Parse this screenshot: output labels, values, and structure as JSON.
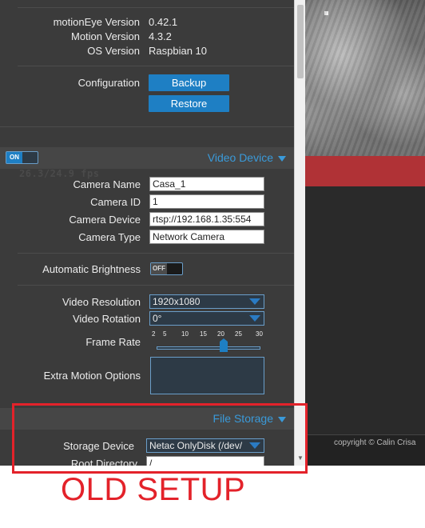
{
  "info": {
    "motioneye_version_label": "motionEye Version",
    "motioneye_version_value": "0.42.1",
    "motion_version_label": "Motion Version",
    "motion_version_value": "4.3.2",
    "os_version_label": "OS Version",
    "os_version_value": "Raspbian 10"
  },
  "configuration": {
    "label": "Configuration",
    "backup_label": "Backup",
    "restore_label": "Restore"
  },
  "video_device": {
    "toggle_label": "ON",
    "title": "Video Device",
    "camera_name_label": "Camera Name",
    "camera_name_value": "Casa_1",
    "camera_id_label": "Camera ID",
    "camera_id_value": "1",
    "camera_device_label": "Camera Device",
    "camera_device_value": "rtsp://192.168.1.35:554",
    "camera_type_label": "Camera Type",
    "camera_type_value": "Network Camera",
    "auto_brightness_label": "Automatic Brightness",
    "auto_brightness_toggle": "OFF",
    "video_resolution_label": "Video Resolution",
    "video_resolution_value": "1920x1080",
    "video_rotation_label": "Video Rotation",
    "video_rotation_value": "0°",
    "frame_rate_label": "Frame Rate",
    "frame_rate_ticks": [
      "2",
      "5",
      "10",
      "15",
      "20",
      "25",
      "30"
    ],
    "frame_rate_value": 20,
    "extra_motion_options_label": "Extra Motion Options"
  },
  "file_storage": {
    "title": "File Storage",
    "storage_device_label": "Storage Device",
    "storage_device_value": "Netac OnlyDisk (/dev/",
    "root_directory_label": "Root Directory",
    "root_directory_value": "/"
  },
  "preview": {
    "fps_overlay": "26.3/24.9 fps",
    "copyright": "copyright © Calin Crisa"
  },
  "annotation": {
    "text": "OLD SETUP"
  },
  "colors": {
    "accent": "#1e7fc4",
    "header_link": "#3a9ad9",
    "annotation": "#e3222a",
    "panel_bg": "#3b3b3b"
  }
}
